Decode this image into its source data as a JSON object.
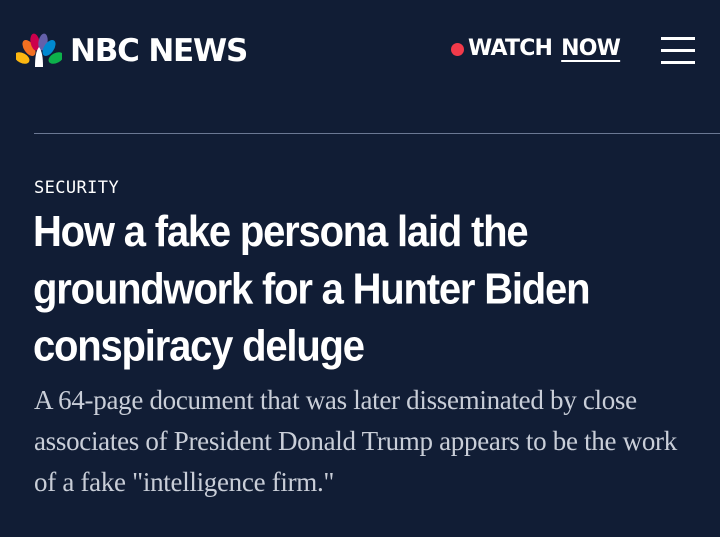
{
  "header": {
    "brand_name": "NBC NEWS",
    "watch_label": "WATCH",
    "watch_now": "NOW",
    "menu_icon": "hamburger-menu-icon",
    "logo_icon": "nbc-peacock-logo-icon"
  },
  "article": {
    "section": "SECURITY",
    "headline": "How a fake persona laid the groundwork for a Hunter Biden conspiracy deluge",
    "dek": "A 64-page document that was later disseminated by close associates of President Donald Trump appears to be the work of a fake \"intelligence firm.\""
  },
  "colors": {
    "background": "#111d35",
    "live_dot": "#f23a4a",
    "text": "#ffffff",
    "dek_text": "#c9ced8"
  }
}
